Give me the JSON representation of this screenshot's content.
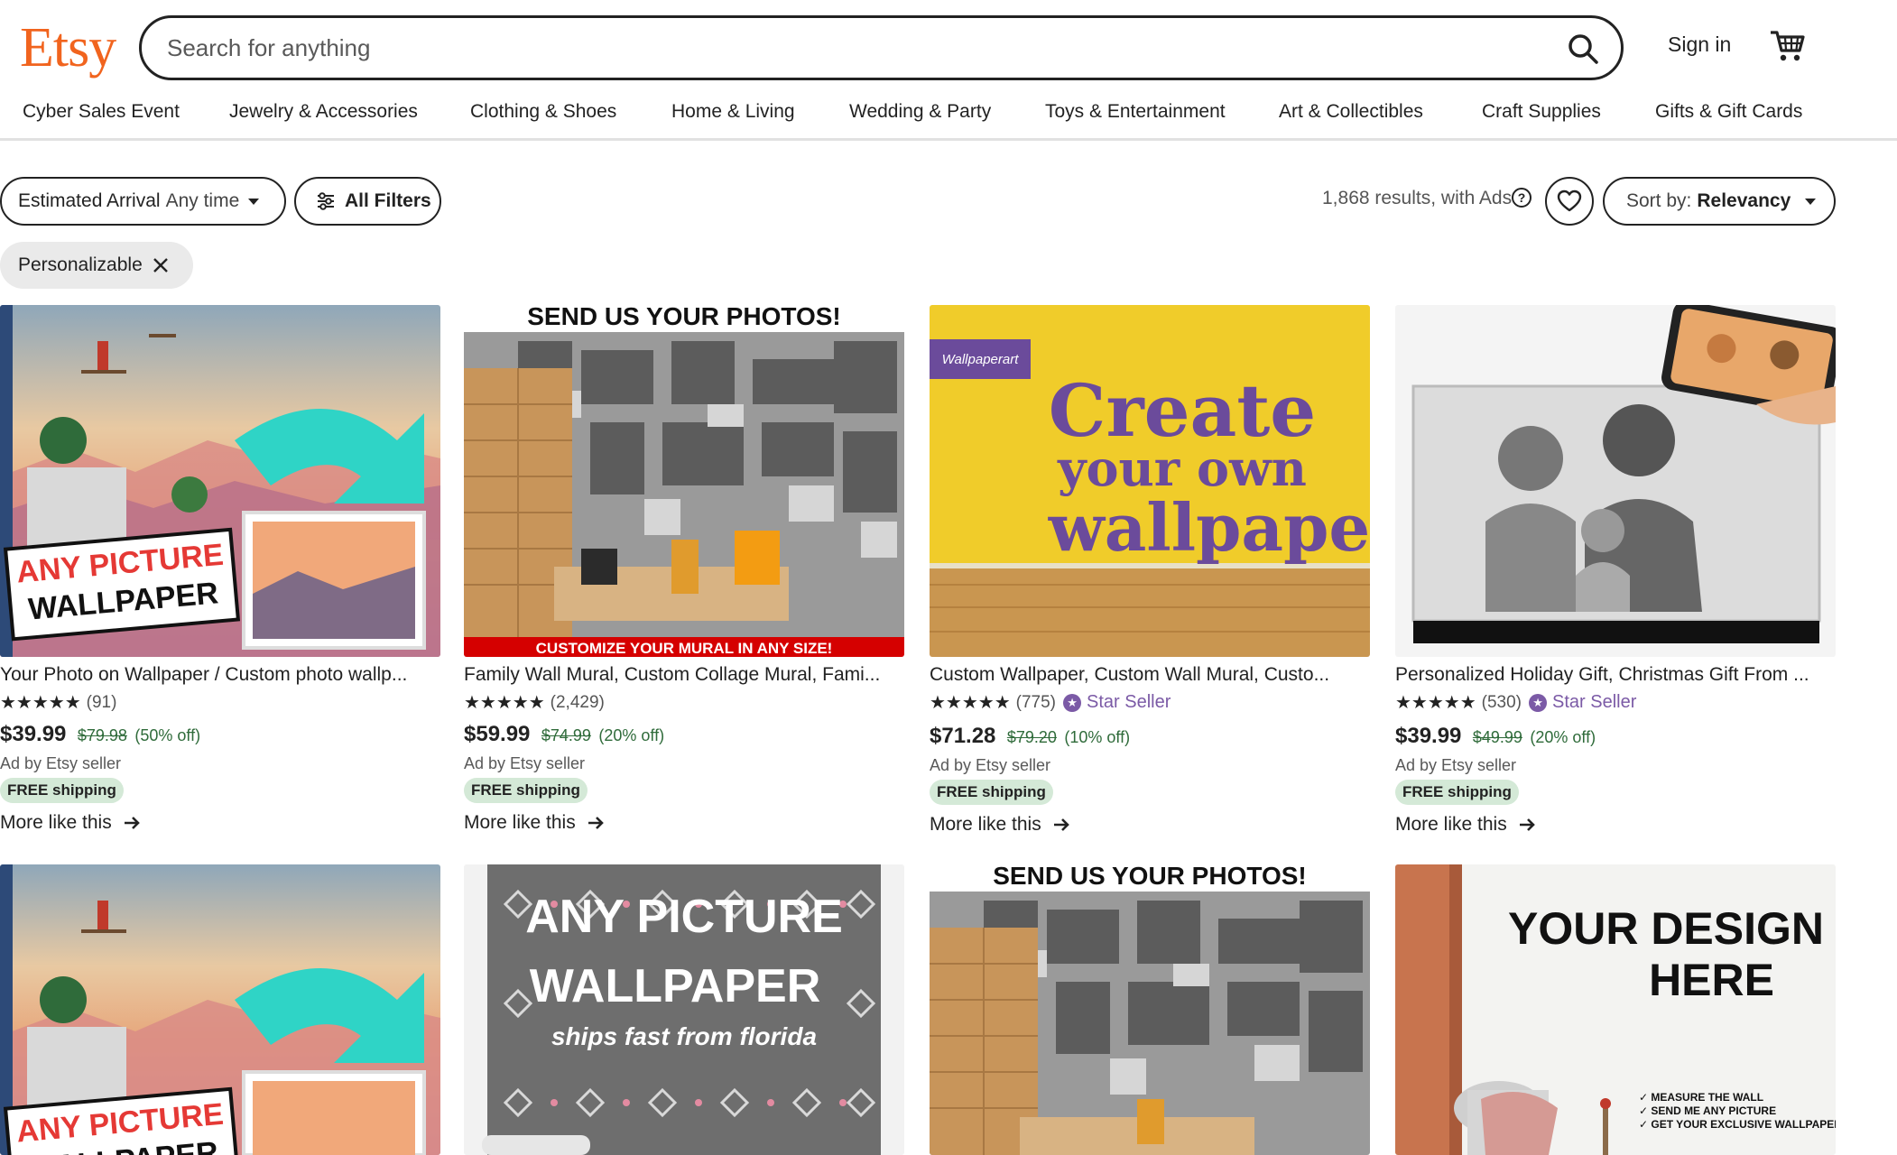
{
  "header": {
    "logo": "Etsy",
    "search_placeholder": "Search for anything",
    "sign_in": "Sign in"
  },
  "nav": {
    "items": [
      "Cyber Sales Event",
      "Jewelry & Accessories",
      "Clothing & Shoes",
      "Home & Living",
      "Wedding & Party",
      "Toys & Entertainment",
      "Art & Collectibles",
      "Craft Supplies",
      "Gifts & Gift Cards"
    ]
  },
  "filters": {
    "arrival_label": "Estimated Arrival",
    "arrival_value": "Any time",
    "all_filters": "All Filters",
    "results_text": "1,868 results, with Ads",
    "sort_label": "Sort by:",
    "sort_value": "Relevancy",
    "active_chip": "Personalizable"
  },
  "listings": [
    {
      "title": "Your Photo on Wallpaper / Custom photo wallp...",
      "stars": "★★★★★",
      "reviews": "(91)",
      "star_seller": "",
      "price": "$39.99",
      "original_price": "$79.98",
      "discount": "(50% off)",
      "ad_label": "Ad by Etsy seller",
      "shipping": "FREE shipping",
      "more_like": "More like this",
      "image_text": [
        "ANY PICTURE",
        "WALLPAPER"
      ]
    },
    {
      "title": "Family Wall Mural, Custom Collage Mural, Fami...",
      "stars": "★★★★★",
      "reviews": "(2,429)",
      "star_seller": "",
      "price": "$59.99",
      "original_price": "$74.99",
      "discount": "(20% off)",
      "ad_label": "Ad by Etsy seller",
      "shipping": "FREE shipping",
      "more_like": "More like this",
      "image_text": [
        "SEND US YOUR PHOTOS!",
        "CUSTOMIZE YOUR MURAL IN ANY SIZE!"
      ]
    },
    {
      "title": "Custom Wallpaper, Custom Wall Mural, Custo...",
      "stars": "★★★★★",
      "reviews": "(775)",
      "star_seller": "Star Seller",
      "price": "$71.28",
      "original_price": "$79.20",
      "discount": "(10% off)",
      "ad_label": "Ad by Etsy seller",
      "shipping": "FREE shipping",
      "more_like": "More like this",
      "image_text": [
        "Wallpaperart",
        "Create",
        "your own",
        "wallpape"
      ]
    },
    {
      "title": "Personalized Holiday Gift, Christmas Gift From ...",
      "stars": "★★★★★",
      "reviews": "(530)",
      "star_seller": "Star Seller",
      "price": "$39.99",
      "original_price": "$49.99",
      "discount": "(20% off)",
      "ad_label": "Ad by Etsy seller",
      "shipping": "FREE shipping",
      "more_like": "More like this",
      "image_text": []
    }
  ],
  "listings_row2": [
    {
      "image_text": [
        "ANY PICTURE",
        "WALLPAPER"
      ]
    },
    {
      "image_text": [
        "ANY PICTURE",
        "WALLPAPER",
        "ships fast from florida"
      ]
    },
    {
      "image_text": [
        "SEND US YOUR PHOTOS!"
      ]
    },
    {
      "image_text": [
        "YOUR DESIGN",
        "HERE",
        "✓ MEASURE THE WALL",
        "✓ SEND ME ANY PICTURE",
        "✓ GET YOUR EXCLUSIVE WALLPAPER"
      ]
    }
  ],
  "colors": {
    "brand": "#F1641E",
    "star_seller": "#7b5aa6",
    "discount_green": "#2f6b3a",
    "shipping_bg": "#d4e9d7"
  }
}
